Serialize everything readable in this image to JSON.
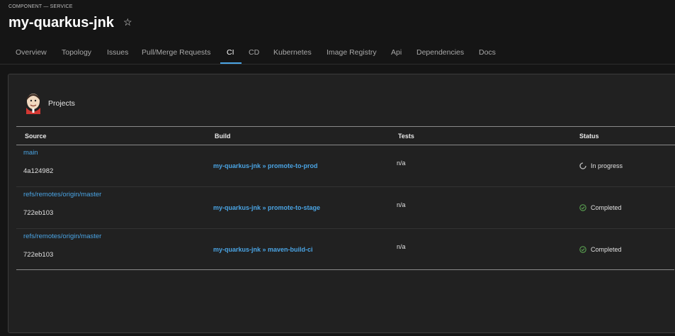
{
  "header": {
    "kind": "COMPONENT — SERVICE",
    "title": "my-quarkus-jnk",
    "star_icon": "star-outline-icon"
  },
  "tabs": [
    {
      "label": "Overview",
      "active": false
    },
    {
      "label": "Topology",
      "active": false
    },
    {
      "label": "Issues",
      "active": false
    },
    {
      "label": "Pull/Merge Requests",
      "active": false
    },
    {
      "label": "CI",
      "active": true
    },
    {
      "label": "CD",
      "active": false
    },
    {
      "label": "Kubernetes",
      "active": false
    },
    {
      "label": "Image Registry",
      "active": false
    },
    {
      "label": "Api",
      "active": false
    },
    {
      "label": "Dependencies",
      "active": false
    },
    {
      "label": "Docs",
      "active": false
    }
  ],
  "card": {
    "title": "Projects",
    "icon": "jenkins-icon",
    "columns": [
      "Source",
      "Build",
      "Tests",
      "Status"
    ],
    "rows": [
      {
        "source": "main",
        "commit": "4a124982",
        "build": "my-quarkus-jnk » promote-to-prod",
        "tests": "n/a",
        "status": "In progress",
        "status_icon": "spinner-icon"
      },
      {
        "source": "refs/remotes/origin/master",
        "commit": "722eb103",
        "build": "my-quarkus-jnk » promote-to-stage",
        "tests": "n/a",
        "status": "Completed",
        "status_icon": "check-circle-icon"
      },
      {
        "source": "refs/remotes/origin/master",
        "commit": "722eb103",
        "build": "my-quarkus-jnk » maven-build-ci",
        "tests": "n/a",
        "status": "Completed",
        "status_icon": "check-circle-icon"
      }
    ]
  },
  "colors": {
    "accent": "#4aa4e4",
    "success": "#5ba352",
    "background": "#151515",
    "card": "#212121"
  }
}
